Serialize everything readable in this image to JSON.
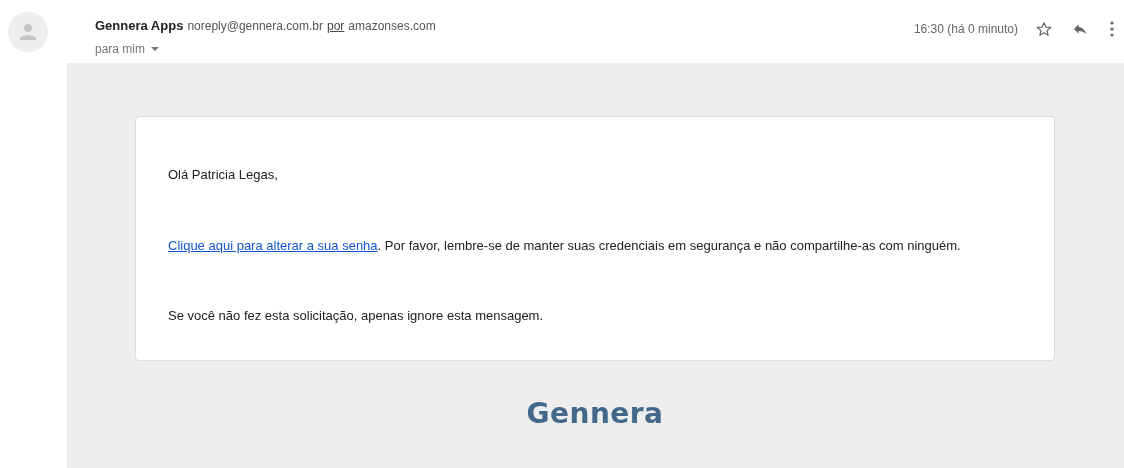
{
  "sender": {
    "name": "Gennera Apps",
    "email": "noreply@gennera.com.br",
    "via_label": "por",
    "via_domain": "amazonses.com",
    "recipient": "para mim"
  },
  "time": "16:30 (há 0 minuto)",
  "starred": false,
  "message": {
    "greeting": "Olá Patricia Legas,",
    "link_text": "Clique aqui para alterar a sua senha",
    "link_rest": ". Por favor, lembre-se de manter suas credenciais em segurança e não compartilhe-as com ninguém.",
    "note": "Se você não fez esta solicitação, apenas ignore esta mensagem."
  },
  "footer_logo": "Gennera"
}
